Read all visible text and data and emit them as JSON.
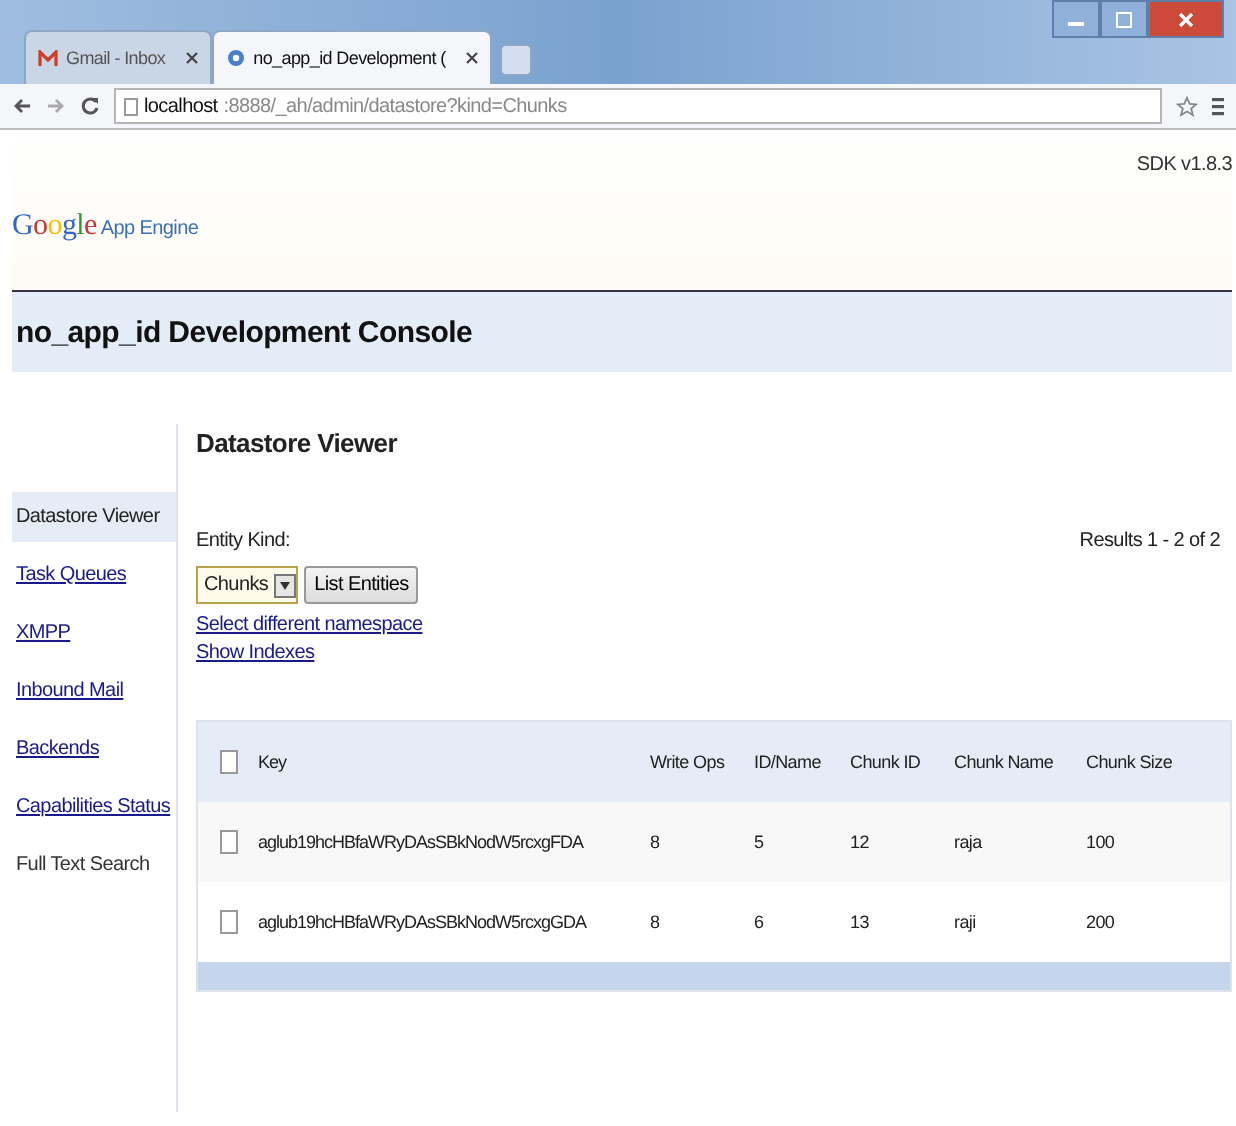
{
  "browser": {
    "tabs": [
      {
        "title": "Gmail - Inbox",
        "selected": false,
        "kind": "gmail"
      },
      {
        "title": "no_app_id Development (",
        "selected": true,
        "kind": "appengine"
      }
    ],
    "address": {
      "host": "localhost",
      "rest": ":8888/_ah/admin/datastore?kind=Chunks"
    }
  },
  "header": {
    "sdk_version": "SDK v1.8.3",
    "logo": {
      "word": "Google",
      "product": "App Engine"
    }
  },
  "console_title": "no_app_id Development Console",
  "sidebar": {
    "items": [
      {
        "label": "Datastore Viewer",
        "selected": true,
        "link": false
      },
      {
        "label": "Task Queues",
        "selected": false,
        "link": true
      },
      {
        "label": "XMPP",
        "selected": false,
        "link": true
      },
      {
        "label": "Inbound Mail",
        "selected": false,
        "link": true
      },
      {
        "label": "Backends",
        "selected": false,
        "link": true
      },
      {
        "label": "Capabilities Status",
        "selected": false,
        "link": true
      },
      {
        "label": "Full Text Search",
        "selected": false,
        "link": false
      }
    ]
  },
  "main": {
    "heading": "Datastore Viewer",
    "entity_kind_label": "Entity Kind:",
    "entity_kind": "Chunks",
    "list_button": "List Entities",
    "links": [
      "Select different namespace",
      "Show Indexes"
    ],
    "results": "Results 1 - 2 of 2",
    "table": {
      "header_checked": false,
      "columns": [
        "Key",
        "Write Ops",
        "ID/Name",
        "Chunk ID",
        "Chunk Name",
        "Chunk Size"
      ],
      "rows": [
        {
          "checked": false,
          "cells": [
            "aglub19hcHBfaWRyDAsSBkNodW5rcxgFDA",
            "8",
            "5",
            "12",
            "raja",
            "100"
          ]
        },
        {
          "checked": false,
          "cells": [
            "aglub19hcHBfaWRyDAsSBkNodW5rcxgGDA",
            "8",
            "6",
            "13",
            "raji",
            "200"
          ]
        }
      ]
    }
  }
}
